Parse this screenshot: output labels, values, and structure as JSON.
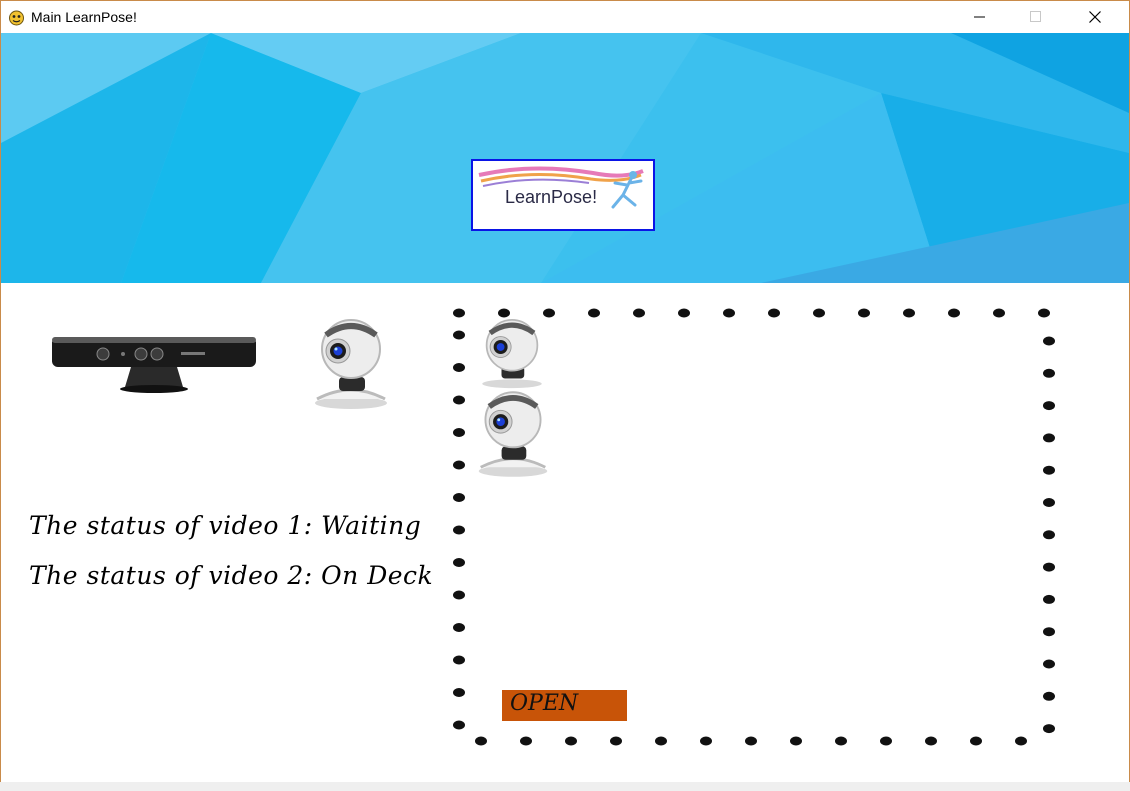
{
  "window": {
    "title": "Main LearnPose!",
    "controls": {
      "minimize": "minimize-icon",
      "maximize": "maximize-icon",
      "close": "close-icon"
    }
  },
  "banner": {
    "logo_text": "LearnPose!",
    "colors": {
      "base": "#3cc0ee",
      "accent": "#1bb1ea",
      "light": "#7fd4f5"
    }
  },
  "devices": {
    "kinect_icon": "kinect-sensor-icon",
    "webcam_icon": "webcam-icon"
  },
  "status": {
    "video1": "The status of video 1: Waiting",
    "video2": "The status of video 2: On Deck"
  },
  "drop_zone": {
    "icons": [
      "webcam-icon",
      "webcam-icon"
    ]
  },
  "open_button": {
    "label": "OPEN",
    "color": "#c85408"
  }
}
